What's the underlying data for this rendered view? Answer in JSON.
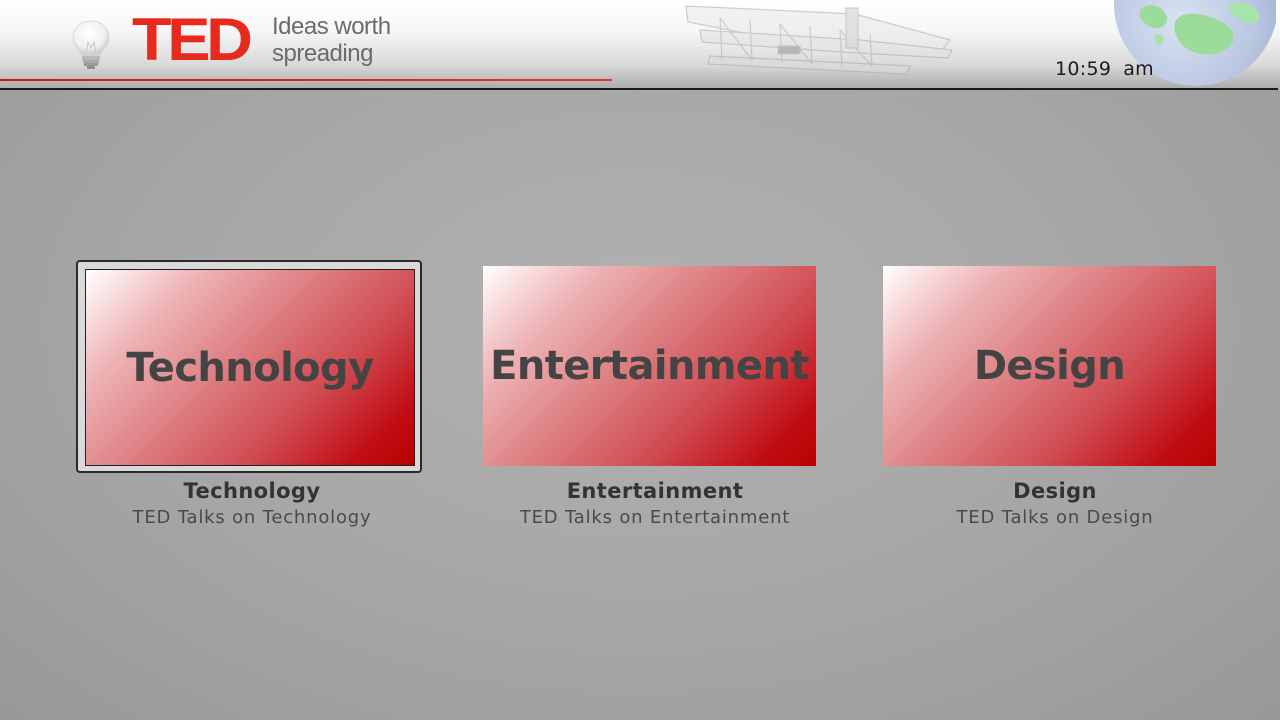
{
  "header": {
    "logo_text": "TED",
    "tagline_line1": "Ideas worth",
    "tagline_line2": "spreading",
    "clock_time": "10:59",
    "clock_period": "am",
    "brand_color": "#e62b1e"
  },
  "categories": [
    {
      "tile_text": "Technology",
      "title": "Technology",
      "subtitle": "TED Talks on Technology",
      "focused": true
    },
    {
      "tile_text": "Entertainment",
      "title": "Entertainment",
      "subtitle": "TED Talks on Entertainment",
      "focused": false
    },
    {
      "tile_text": "Design",
      "title": "Design",
      "subtitle": "TED Talks on Design",
      "focused": false
    }
  ],
  "icons": {
    "bulb": "lightbulb-icon",
    "plane": "biplane-art",
    "globe": "globe-art"
  },
  "colors": {
    "tile_gradient_start": "#ffffff",
    "tile_gradient_end": "#b80000",
    "background": "#a8a8a8"
  }
}
